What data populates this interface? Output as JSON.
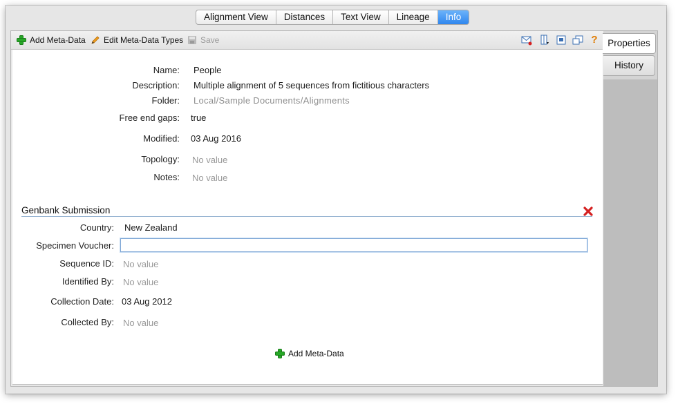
{
  "tabs": [
    "Alignment View",
    "Distances",
    "Text View",
    "Lineage",
    "Info"
  ],
  "active_tab": "Info",
  "toolbar": {
    "add_label": "Add Meta-Data",
    "edit_label": "Edit Meta-Data Types",
    "save_label": "Save"
  },
  "toolbar_right_icons": [
    "mail-icon",
    "columns-icon",
    "window-restore-icon",
    "new-window-icon",
    "help-icon"
  ],
  "side_tabs": [
    "Properties",
    "History"
  ],
  "active_side_tab": "Properties",
  "properties": [
    {
      "label": "Name:",
      "value": "People"
    },
    {
      "label": "Description:",
      "value": "Multiple alignment of 5 sequences from fictitious characters"
    },
    {
      "label": "Folder:",
      "value": "Local/Sample Documents/Alignments"
    },
    {
      "label": "Free end gaps:",
      "value": "true"
    },
    {
      "label": "Modified:",
      "value": "03 Aug 2016"
    },
    {
      "label": "Topology:",
      "value": "No value"
    },
    {
      "label": "Notes:",
      "value": "No value"
    }
  ],
  "section": {
    "title": "Genbank Submission",
    "fields": [
      {
        "label": "Country:",
        "value": "New Zealand"
      },
      {
        "label": "Specimen Voucher:",
        "value": ""
      },
      {
        "label": "Sequence ID:",
        "value": "No value"
      },
      {
        "label": "Identified By:",
        "value": "No value"
      },
      {
        "label": "Collection Date:",
        "value": "03 Aug 2012"
      },
      {
        "label": "Collected By:",
        "value": "No value"
      }
    ]
  },
  "bottom_add_label": "Add Meta-Data",
  "colors": {
    "accent": "#2f86ee",
    "remove": "#d42020",
    "add": "#27a827"
  }
}
